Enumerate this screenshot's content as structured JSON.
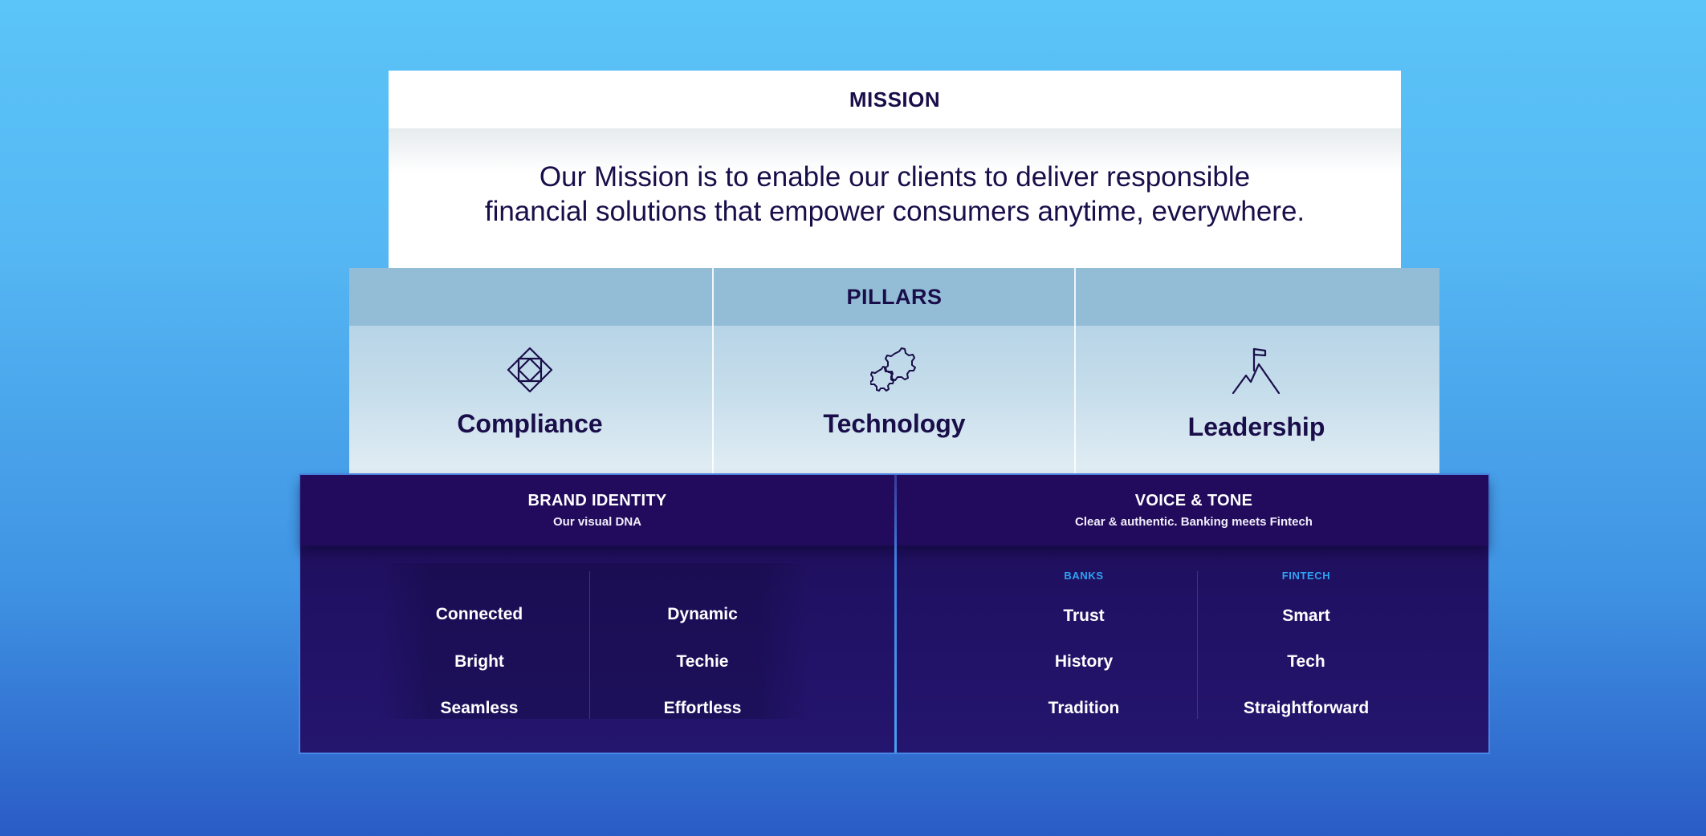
{
  "mission": {
    "title": "MISSION",
    "line1": "Our Mission is to enable our clients to deliver responsible",
    "line2": "financial solutions that empower consumers anytime, everywhere."
  },
  "pillars": {
    "title": "PILLARS",
    "items": [
      {
        "label": "Compliance",
        "icon": "diamond-frame-icon"
      },
      {
        "label": "Technology",
        "icon": "gears-icon"
      },
      {
        "label": "Leadership",
        "icon": "mountain-flag-icon"
      }
    ]
  },
  "brand_identity": {
    "title": "BRAND IDENTITY",
    "subtitle": "Our visual DNA",
    "col1": [
      "Connected",
      "Bright",
      "Seamless"
    ],
    "col2": [
      "Dynamic",
      "Techie",
      "Effortless"
    ]
  },
  "voice_tone": {
    "title": "VOICE & TONE",
    "subtitle": "Clear & authentic. Banking meets Fintech",
    "banks_label": "BANKS",
    "fintech_label": "FINTECH",
    "banks": [
      "Trust",
      "History",
      "Tradition"
    ],
    "fintech": [
      "Smart",
      "Tech",
      "Straightforward"
    ]
  },
  "colors": {
    "navy": "#1a0e4a",
    "panel": "#211164",
    "accent_blue": "#2ea3f2",
    "sky": "#5bc4f8"
  }
}
